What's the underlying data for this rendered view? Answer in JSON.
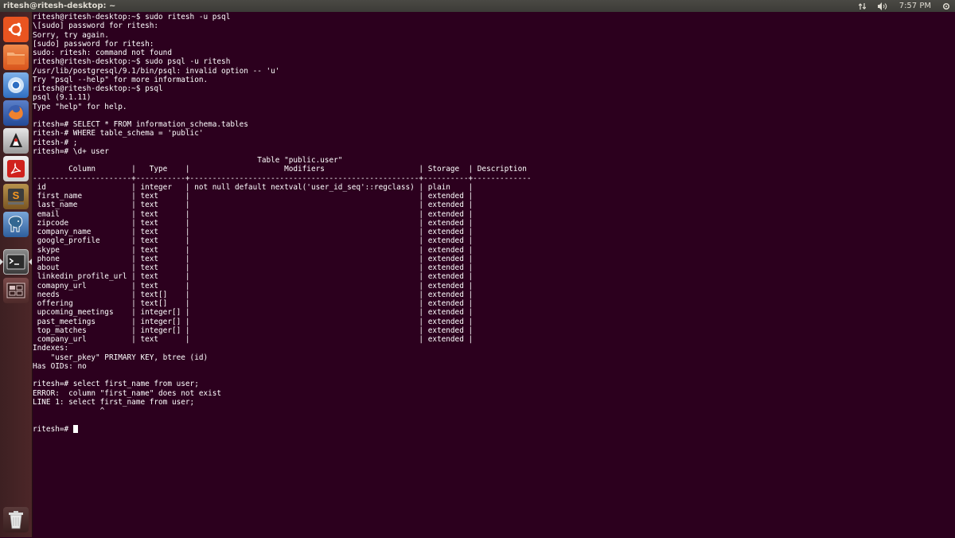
{
  "topbar": {
    "title": "ritesh@ritesh-desktop: ~",
    "network_icon": "network-arrows-icon",
    "volume_icon": "speaker-icon",
    "time": "7:57 PM",
    "settings_icon": "power-gear-icon"
  },
  "launcher": {
    "items": [
      {
        "name": "dash-home",
        "icon": "ubuntu-logo-icon",
        "color": "#e95420"
      },
      {
        "name": "files",
        "icon": "folder-icon",
        "color": "#e66a2c"
      },
      {
        "name": "chromium",
        "icon": "chromium-icon",
        "color": "#3a7bd5"
      },
      {
        "name": "firefox",
        "icon": "firefox-icon",
        "color": "#e8632d"
      },
      {
        "name": "java-app",
        "icon": "duke-icon",
        "color": "#d8d8d8"
      },
      {
        "name": "pdf-reader",
        "icon": "pdf-icon",
        "color": "#d0211d"
      },
      {
        "name": "sublime-text",
        "icon": "sublime-icon",
        "color": "#9b6e2f"
      },
      {
        "name": "pgadmin",
        "icon": "elephant-icon",
        "color": "#4a84c6"
      },
      {
        "name": "terminal",
        "icon": "terminal-icon",
        "color": "#3a3a3a"
      },
      {
        "name": "workspaces",
        "icon": "workspace-switcher-icon",
        "color": "#6b3a3a"
      }
    ],
    "trash_icon": "trash-icon"
  },
  "terminal": {
    "lines": [
      "ritesh@ritesh-desktop:~$ sudo ritesh -u psql",
      "\\[sudo] password for ritesh:",
      "Sorry, try again.",
      "[sudo] password for ritesh:",
      "sudo: ritesh: command not found",
      "ritesh@ritesh-desktop:~$ sudo psql -u ritesh",
      "/usr/lib/postgresql/9.1/bin/psql: invalid option -- 'u'",
      "Try \"psql --help\" for more information.",
      "ritesh@ritesh-desktop:~$ psql",
      "psql (9.1.11)",
      "Type \"help\" for help.",
      "",
      "ritesh=# SELECT * FROM information_schema.tables",
      "ritesh-# WHERE table_schema = 'public'",
      "ritesh-# ;",
      "ritesh=# \\d+ user",
      "                                                  Table \"public.user\"",
      "        Column        |   Type    |                     Modifiers                     | Storage  | Description",
      "----------------------+-----------+---------------------------------------------------+----------+-------------",
      " id                   | integer   | not null default nextval('user_id_seq'::regclass) | plain    |",
      " first_name           | text      |                                                   | extended |",
      " last_name            | text      |                                                   | extended |",
      " email                | text      |                                                   | extended |",
      " zipcode              | text      |                                                   | extended |",
      " company_name         | text      |                                                   | extended |",
      " google_profile       | text      |                                                   | extended |",
      " skype                | text      |                                                   | extended |",
      " phone                | text      |                                                   | extended |",
      " about                | text      |                                                   | extended |",
      " linkedin_profile_url | text      |                                                   | extended |",
      " comapny_url          | text      |                                                   | extended |",
      " needs                | text[]    |                                                   | extended |",
      " offering             | text[]    |                                                   | extended |",
      " upcoming_meetings    | integer[] |                                                   | extended |",
      " past_meetings        | integer[] |                                                   | extended |",
      " top_matches          | integer[] |                                                   | extended |",
      " company_url          | text      |                                                   | extended |",
      "Indexes:",
      "    \"user_pkey\" PRIMARY KEY, btree (id)",
      "Has OIDs: no",
      "",
      "ritesh=# select first_name from user;",
      "ERROR:  column \"first_name\" does not exist",
      "LINE 1: select first_name from user;",
      "               ^"
    ],
    "prompt": "ritesh=# ",
    "foreground": "#ffffff",
    "background": "#2c001e"
  }
}
